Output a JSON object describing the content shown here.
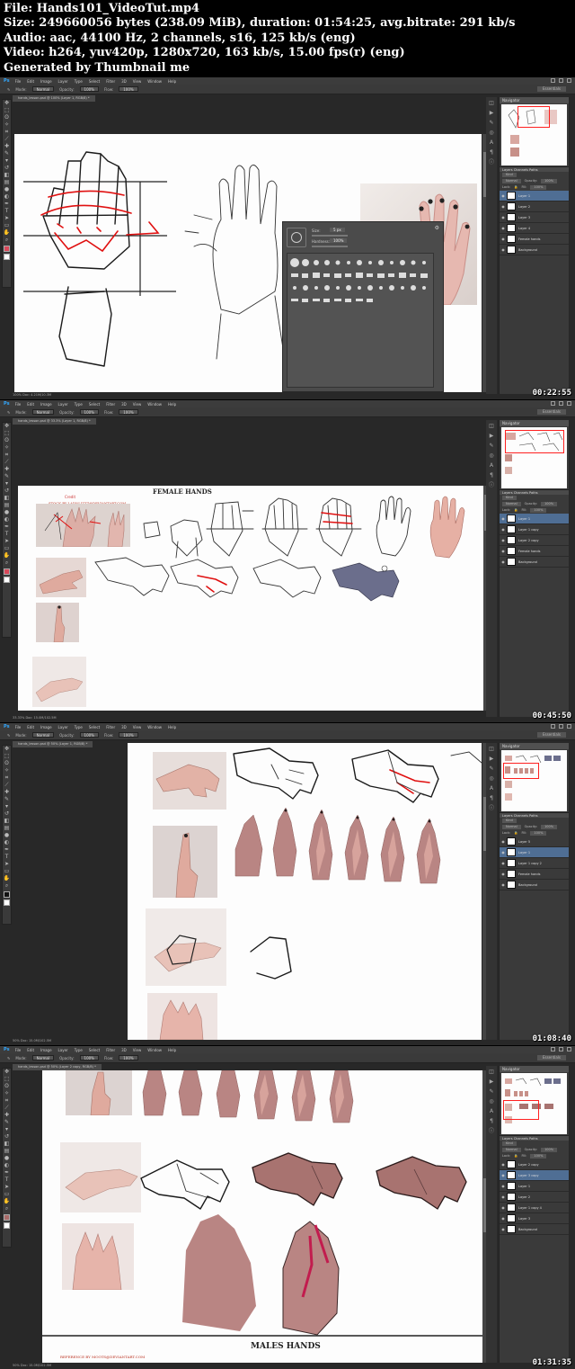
{
  "header": {
    "file_line": "File: Hands101_VideoTut.mp4",
    "size_line": "Size: 249660056 bytes (238.09 MiB), duration: 01:54:25, avg.bitrate: 291 kb/s",
    "audio_line": "Audio: aac, 44100 Hz, 2 channels, s16, 125 kb/s (eng)",
    "video_line": "Video: h264, yuv420p, 1280x720, 163 kb/s, 15.00 fps(r) (eng)",
    "generated_line": "Generated by Thumbnail me"
  },
  "menu": {
    "app": "Ps",
    "items": [
      "File",
      "Edit",
      "Image",
      "Layer",
      "Type",
      "Select",
      "Filter",
      "3D",
      "View",
      "Window",
      "Help"
    ]
  },
  "options": {
    "mode_label": "Mode:",
    "mode_value": "Normal",
    "opacity_label": "Opacity:",
    "opacity_value": "100%",
    "flow_label": "Flow:",
    "flow_value": "100%",
    "workspace": "Essentials"
  },
  "panels": {
    "navigator_title": "Navigator",
    "layers_tabs": "Layers  Channels  Paths",
    "kind_label": "Kind",
    "blend_value": "Normal",
    "opacity_label": "Opacity:",
    "opacity_value": "100%",
    "lock_label": "Lock:",
    "fill_label": "Fill:",
    "fill_value": "100%"
  },
  "brush_picker": {
    "size_label": "Size:",
    "size_value": "5 px",
    "hardness_label": "Hardness:",
    "hardness_value": "100%"
  },
  "frames": [
    {
      "timestamp": "00:22:55",
      "doc_tab": "hands_lesson.psd @ 100% (Layer 1, RGB/8) *",
      "status": "100%     Doc: 4.21M/10.3M",
      "layers": [
        "Layer 1",
        "Layer 2",
        "Layer 3",
        "Layer 4",
        "Female hands",
        "Background"
      ],
      "selected_layer": 0
    },
    {
      "timestamp": "00:45:50",
      "doc_tab": "hands_lesson.psd @ 33.3% (Layer 1, RGB/8) *",
      "status": "33.33%     Doc: 15.0M/102.5M",
      "layers": [
        "Layer 1",
        "Layer 1 copy",
        "Layer 2 copy",
        "Female hands",
        "Background"
      ],
      "selected_layer": 0,
      "canvas_title": "FEMALE HANDS",
      "credit": "STOCK BY LADY-LIZZZ@DEVIANTART.COM",
      "credit_label": "Credit"
    },
    {
      "timestamp": "01:08:40",
      "doc_tab": "hands_lesson.psd @ 50% (Layer 1, RGB/8) *",
      "status": "50%     Doc: 15.0M/102.5M",
      "layers": [
        "Layer 5",
        "Layer 1",
        "Layer 1 copy 2",
        "Female hands",
        "Background"
      ],
      "selected_layer": 1
    },
    {
      "timestamp": "01:31:35",
      "doc_tab": "hands_lesson.psd @ 50% (Layer 2 copy, RGB/8) *",
      "status": "50%     Doc: 15.0M/102.5M",
      "layers": [
        "Layer 2 copy",
        "Layer 3 copy",
        "Layer 1",
        "Layer 2",
        "Layer 1 copy 4",
        "Layer 3",
        "Background"
      ],
      "selected_layer": 1,
      "canvas_title": "MALES HANDS",
      "credit": "REFERENCE BY MOOTS@DEVIANTART.COM"
    }
  ]
}
